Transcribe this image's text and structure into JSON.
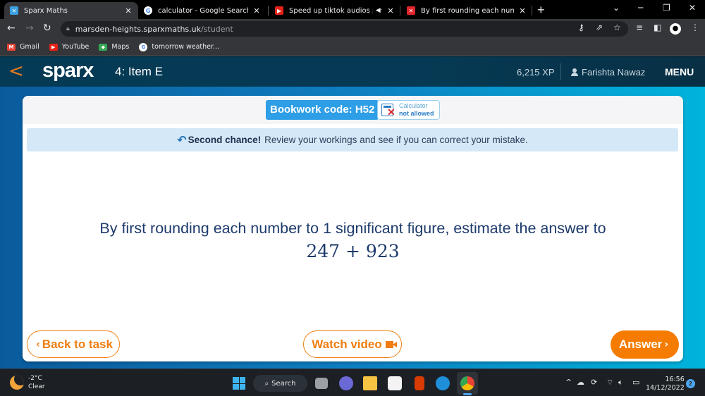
{
  "browser": {
    "tabs": [
      {
        "title": "Sparx Maths",
        "favicon": "sparx-icon",
        "active": true
      },
      {
        "title": "calculator - Google Search",
        "favicon": "google-icon",
        "active": false
      },
      {
        "title": "Speed up tiktok audios part",
        "favicon": "youtube-icon",
        "active": false,
        "muted": true
      },
      {
        "title": "By first rounding each number to",
        "favicon": "sparx-error-icon",
        "active": false
      }
    ],
    "new_tab": "+",
    "url_host": "marsden-heights.sparxmaths.uk",
    "url_path": "/student",
    "bookmarks": [
      {
        "label": "Gmail",
        "icon": "gmail-icon"
      },
      {
        "label": "YouTube",
        "icon": "youtube-icon"
      },
      {
        "label": "Maps",
        "icon": "maps-icon"
      },
      {
        "label": "tomorrow weather...",
        "icon": "google-icon"
      }
    ]
  },
  "header": {
    "back_glyph": "<",
    "logo": "sparx",
    "task_title": "4: Item E",
    "xp": "6,215 XP",
    "user_name": "Farishta Nawaz",
    "menu_label": "MENU"
  },
  "card": {
    "bookwork_code": "Bookwork code: H52",
    "calculator_line1": "Calculator",
    "calculator_line2": "not allowed",
    "second_chance_bold": "Second chance!",
    "second_chance_text": "Review your workings and see if you can correct your mistake.",
    "question": "By first rounding each number to 1 significant figure, estimate the answer to",
    "expression": "247 + 923",
    "back_label": "Back to task",
    "video_label": "Watch video",
    "answer_label": "Answer"
  },
  "colors": {
    "header_bg": "#063953",
    "accent_orange": "#f57c00",
    "bookwork_blue": "#2e9ee6",
    "banner_bg": "#d4e8f7",
    "question_text": "#1d3a6b"
  },
  "taskbar": {
    "temperature": "-2°C",
    "weather": "Clear",
    "search_label": "Search",
    "time": "16:56",
    "date": "14/12/2022",
    "notifications": "2"
  }
}
